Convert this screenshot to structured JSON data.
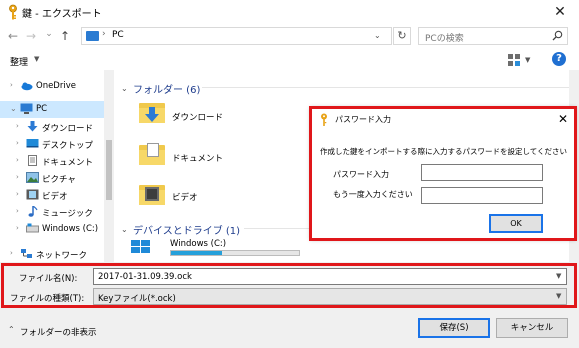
{
  "window": {
    "title": "鍵 - エクスポート",
    "close": "✕"
  },
  "nav": {
    "back": "←",
    "forward": "→",
    "recent": "⌄",
    "up": "↑",
    "address_sep": "›",
    "address": "PC",
    "refresh": "↻",
    "search_placeholder": "PCの検索"
  },
  "toolbar": {
    "organize": "整理",
    "help": "?"
  },
  "sidebar": {
    "items": [
      {
        "label": "OneDrive",
        "icon": "cloud-icon"
      },
      {
        "label": "PC",
        "icon": "pc-icon",
        "selected": true
      },
      {
        "label": "ダウンロード",
        "icon": "download-arrow-icon"
      },
      {
        "label": "デスクトップ",
        "icon": "desktop-icon"
      },
      {
        "label": "ドキュメント",
        "icon": "document-icon"
      },
      {
        "label": "ピクチャ",
        "icon": "picture-icon"
      },
      {
        "label": "ビデオ",
        "icon": "video-icon"
      },
      {
        "label": "ミュージック",
        "icon": "music-icon"
      },
      {
        "label": "Windows (C:)",
        "icon": "drive-icon"
      },
      {
        "label": "ネットワーク",
        "icon": "network-icon"
      }
    ]
  },
  "content": {
    "folders_header": "フォルダー (6)",
    "folders": [
      {
        "label": "ダウンロード"
      },
      {
        "label": "ドキュメント"
      },
      {
        "label": "ビデオ"
      }
    ],
    "drives_header": "デバイスとドライブ (1)",
    "drive_label": "Windows (C:)"
  },
  "dialog": {
    "title": "パスワード入力",
    "message": "作成した鍵をインポートする際に入力するパスワードを設定してください",
    "password_label": "パスワード入力",
    "confirm_label": "もう一度入力ください",
    "ok": "OK"
  },
  "fields": {
    "filename_label": "ファイル名(N):",
    "filename_value": "2017-01-31.09.39.ock",
    "filetype_label": "ファイルの種類(T):",
    "filetype_value": "Keyファイル(*.ock)"
  },
  "footer": {
    "hide_folders": "フォルダーの非表示",
    "save": "保存(S)",
    "cancel": "キャンセル"
  },
  "colors": {
    "accent": "#1a73e8",
    "annotation_red": "#e0171a",
    "selection": "#cce8ff",
    "group_header": "#1e3c8c"
  }
}
